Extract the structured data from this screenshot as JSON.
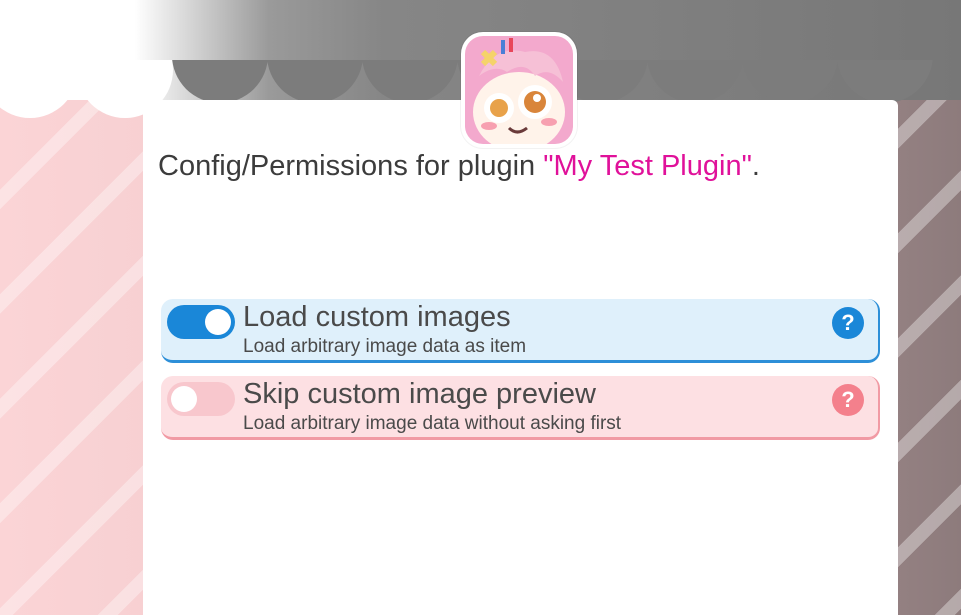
{
  "header": {
    "prefix": "Config/Permissions for plugin ",
    "plugin_name": "\"My Test Plugin\"",
    "suffix": "."
  },
  "avatar": {
    "icon": "plugin-avatar-icon"
  },
  "options": [
    {
      "title": "Load custom images",
      "description": "Load arbitrary image data as item",
      "enabled": true,
      "help_label": "?"
    },
    {
      "title": "Skip custom image preview",
      "description": "Load arbitrary image data without asking first",
      "enabled": false,
      "help_label": "?"
    }
  ],
  "colors": {
    "accent_blue": "#1a87d8",
    "accent_pink": "#e0119a",
    "off_pink": "#f8c7cd"
  }
}
